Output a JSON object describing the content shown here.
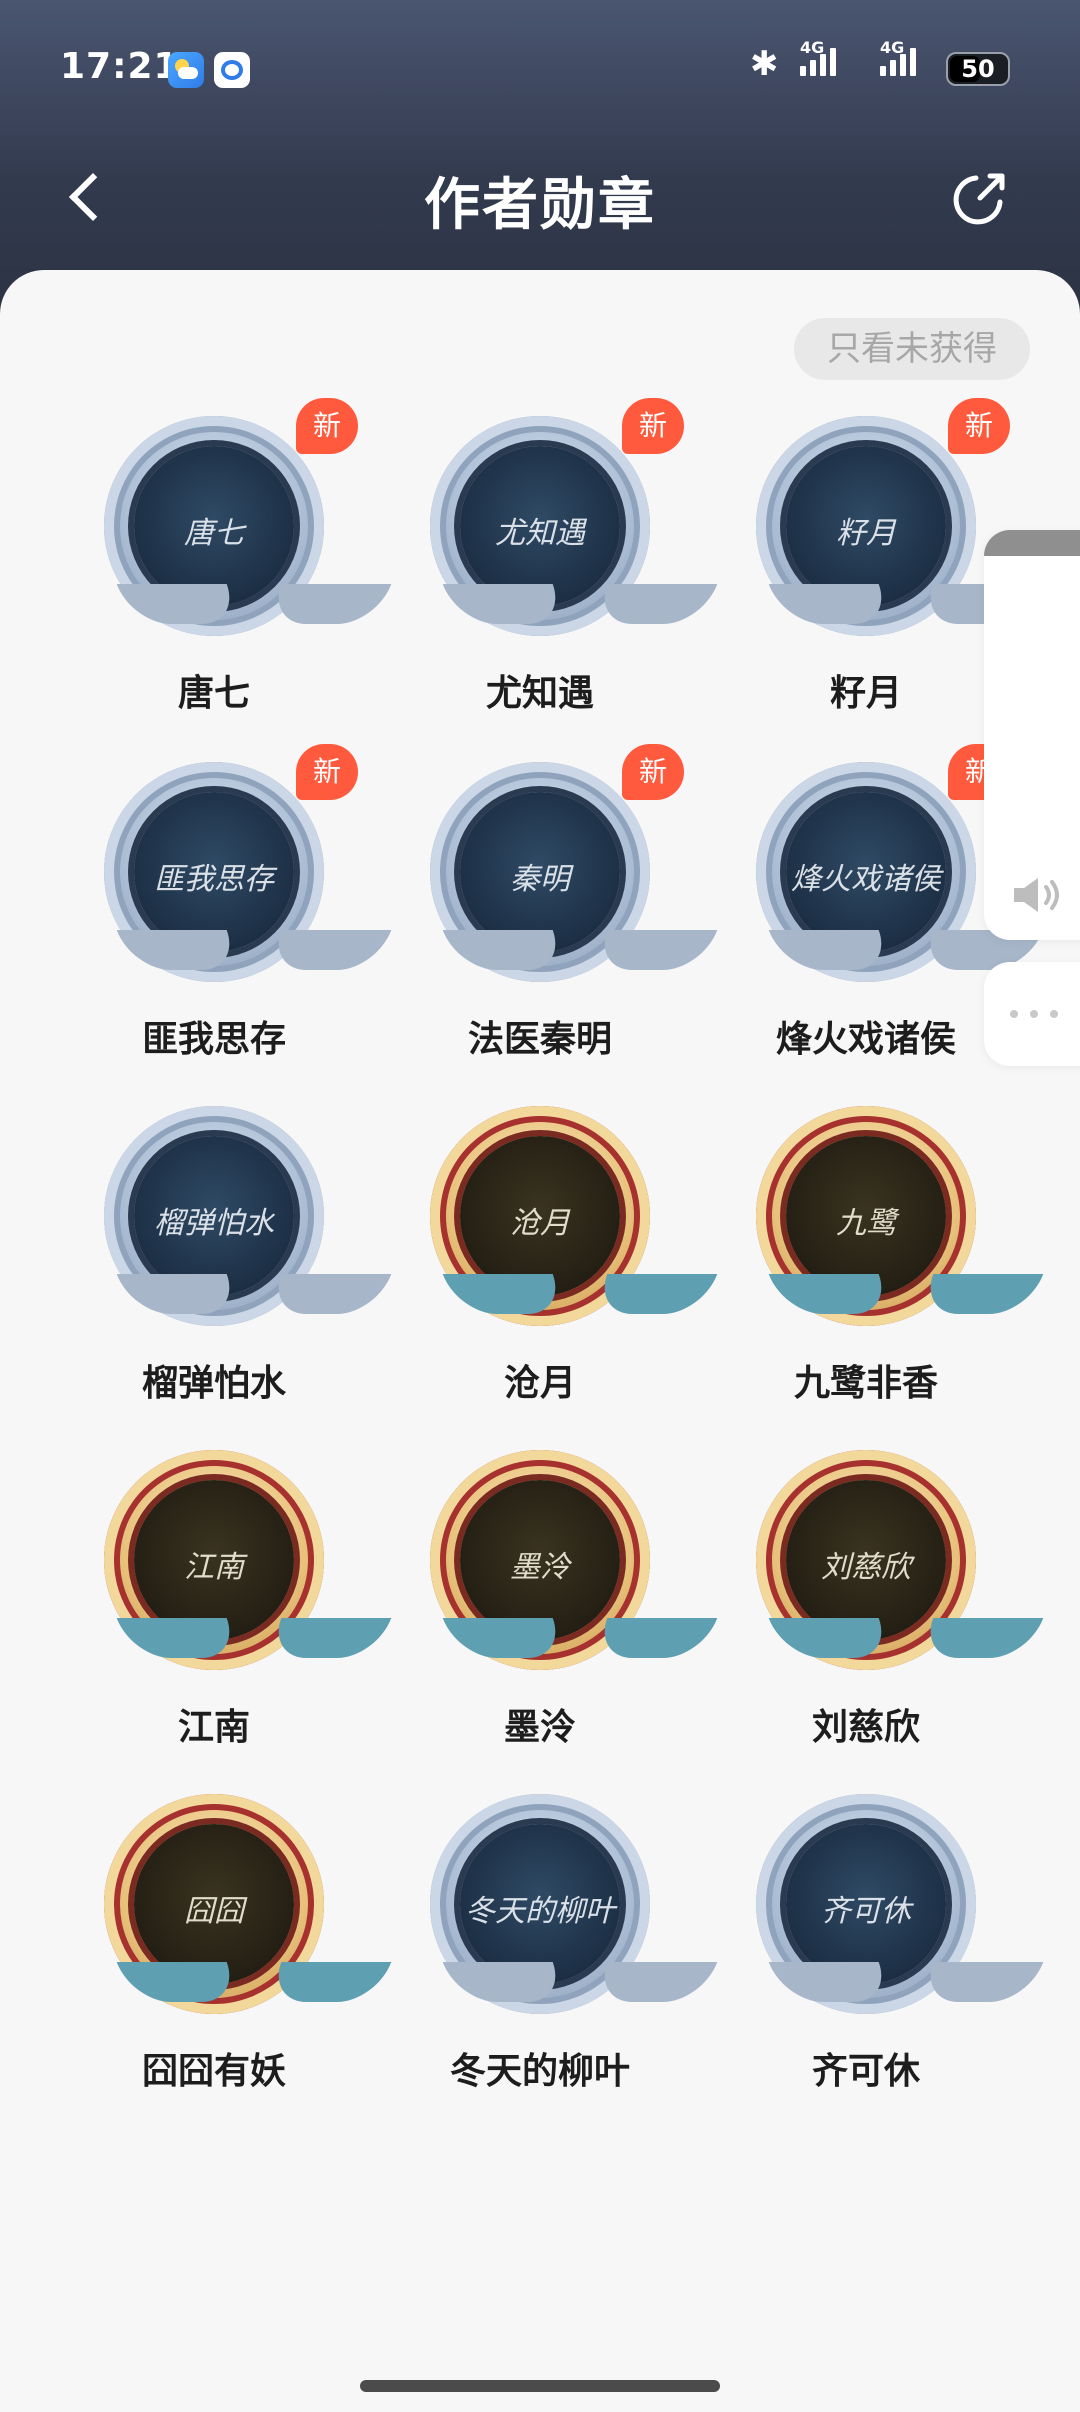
{
  "status_bar": {
    "time": "17:21",
    "network_label_1": "4G",
    "network_label_2": "4G",
    "battery": "50",
    "icons": [
      "weather-icon",
      "baidu-netdisk-icon",
      "bluetooth-icon",
      "signal-icon",
      "signal-icon",
      "battery-icon"
    ]
  },
  "header": {
    "title": "作者勋章",
    "back_icon": "back-chevron-icon",
    "share_icon": "share-icon"
  },
  "filter": {
    "label": "只看未获得"
  },
  "badges": [
    {
      "name": "唐七",
      "new": true,
      "style": "silver",
      "signature": "唐七"
    },
    {
      "name": "尤知遇",
      "new": true,
      "style": "silver",
      "signature": "尤知遇"
    },
    {
      "name": "籽月",
      "new": true,
      "style": "silver",
      "signature": "籽月"
    },
    {
      "name": "匪我思存",
      "new": true,
      "style": "silver",
      "signature": "匪我思存"
    },
    {
      "name": "法医秦明",
      "new": true,
      "style": "silver",
      "signature": "秦明"
    },
    {
      "name": "烽火戏诸侯",
      "new": true,
      "style": "silver",
      "signature": "烽火戏诸侯"
    },
    {
      "name": "榴弹怕水",
      "new": false,
      "style": "silver",
      "signature": "榴弹怕水"
    },
    {
      "name": "沧月",
      "new": false,
      "style": "gold",
      "signature": "沧月"
    },
    {
      "name": "九鹭非香",
      "new": false,
      "style": "gold",
      "signature": "九鹭"
    },
    {
      "name": "江南",
      "new": false,
      "style": "gold",
      "signature": "江南"
    },
    {
      "name": "墨泠",
      "new": false,
      "style": "gold",
      "signature": "墨泠"
    },
    {
      "name": "刘慈欣",
      "new": false,
      "style": "gold",
      "signature": "刘慈欣"
    },
    {
      "name": "囧囧有妖",
      "new": false,
      "style": "gold",
      "signature": "囧囧"
    },
    {
      "name": "冬天的柳叶",
      "new": false,
      "style": "silver",
      "signature": "冬天的柳叶"
    },
    {
      "name": "齐可休",
      "new": false,
      "style": "silver",
      "signature": "齐可休"
    }
  ],
  "new_tag_label": "新",
  "floating": {
    "speaker_icon": "speaker-icon",
    "more_icon": "more-dots-icon"
  }
}
